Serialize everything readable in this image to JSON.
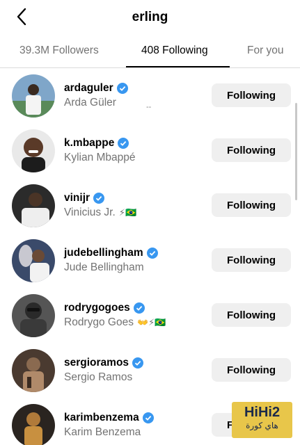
{
  "header": {
    "title": "erling"
  },
  "tabs": [
    {
      "label": "39.3M Followers"
    },
    {
      "label": "408 Following"
    },
    {
      "label": "For you"
    }
  ],
  "accounts": [
    {
      "username": "ardaguler",
      "fullname": "Arda Güler",
      "extra": "",
      "button": "Following"
    },
    {
      "username": "k.mbappe",
      "fullname": "Kylian Mbappé",
      "extra": "",
      "button": "Following"
    },
    {
      "username": "vinijr",
      "fullname": "Vinicius Jr.",
      "extra": "⚡🇧🇷",
      "button": "Following"
    },
    {
      "username": "judebellingham",
      "fullname": "Jude Bellingham",
      "extra": "",
      "button": "Following"
    },
    {
      "username": "rodrygogoes",
      "fullname": "Rodrygo Goes",
      "extra": "👐⚡🇧🇷",
      "button": "Following"
    },
    {
      "username": "sergioramos",
      "fullname": "Sergio Ramos",
      "extra": "",
      "button": "Following"
    },
    {
      "username": "karimbenzema",
      "fullname": "Karim Benzema",
      "extra": "",
      "button": "Following"
    }
  ],
  "misc": {
    "dash": "--"
  },
  "watermark": {
    "top": "HiHi2",
    "bottom": "هاي كورة"
  },
  "colors": {
    "verified": "#3897f0",
    "button_bg": "#efefef",
    "tab_inactive": "#737373"
  }
}
